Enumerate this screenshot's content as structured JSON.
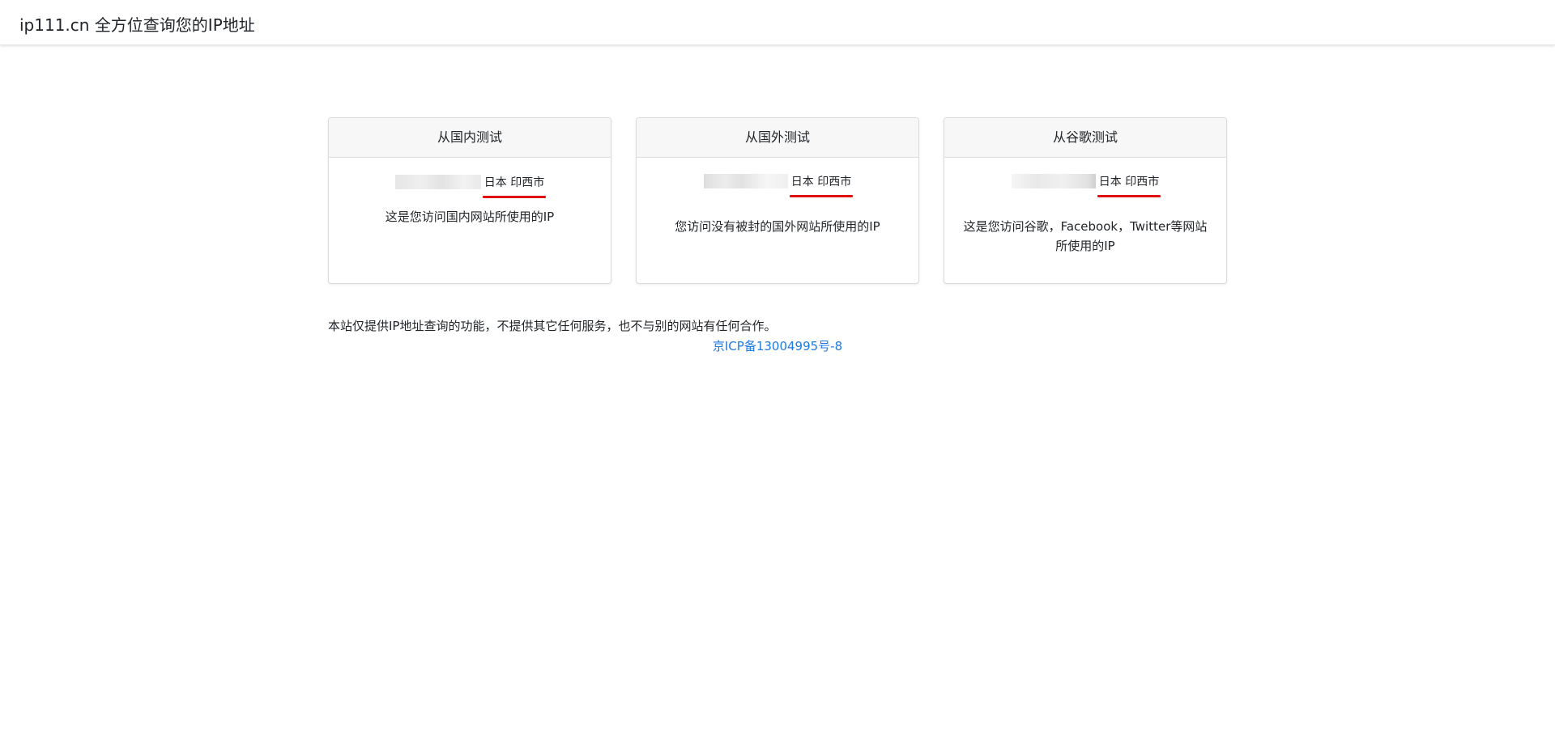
{
  "header": {
    "brand": "ip111.cn 全方位查询您的IP地址"
  },
  "cards": [
    {
      "title": "从国内测试",
      "location": "日本 印西市",
      "description": "这是您访问国内网站所使用的IP"
    },
    {
      "title": "从国外测试",
      "location": "日本 印西市",
      "description": "您访问没有被封的国外网站所使用的IP"
    },
    {
      "title": "从谷歌测试",
      "location": "日本 印西市",
      "description": "这是您访问谷歌，Facebook，Twitter等网站所使用的IP"
    }
  ],
  "footer": {
    "note": "本站仅提供IP地址查询的功能，不提供其它任何服务，也不与别的网站有任何合作。",
    "icp": "京ICP备13004995号-8"
  },
  "colors": {
    "underline": "#e01010",
    "link": "#1f7ae0",
    "card_header_bg": "#f7f7f7"
  }
}
